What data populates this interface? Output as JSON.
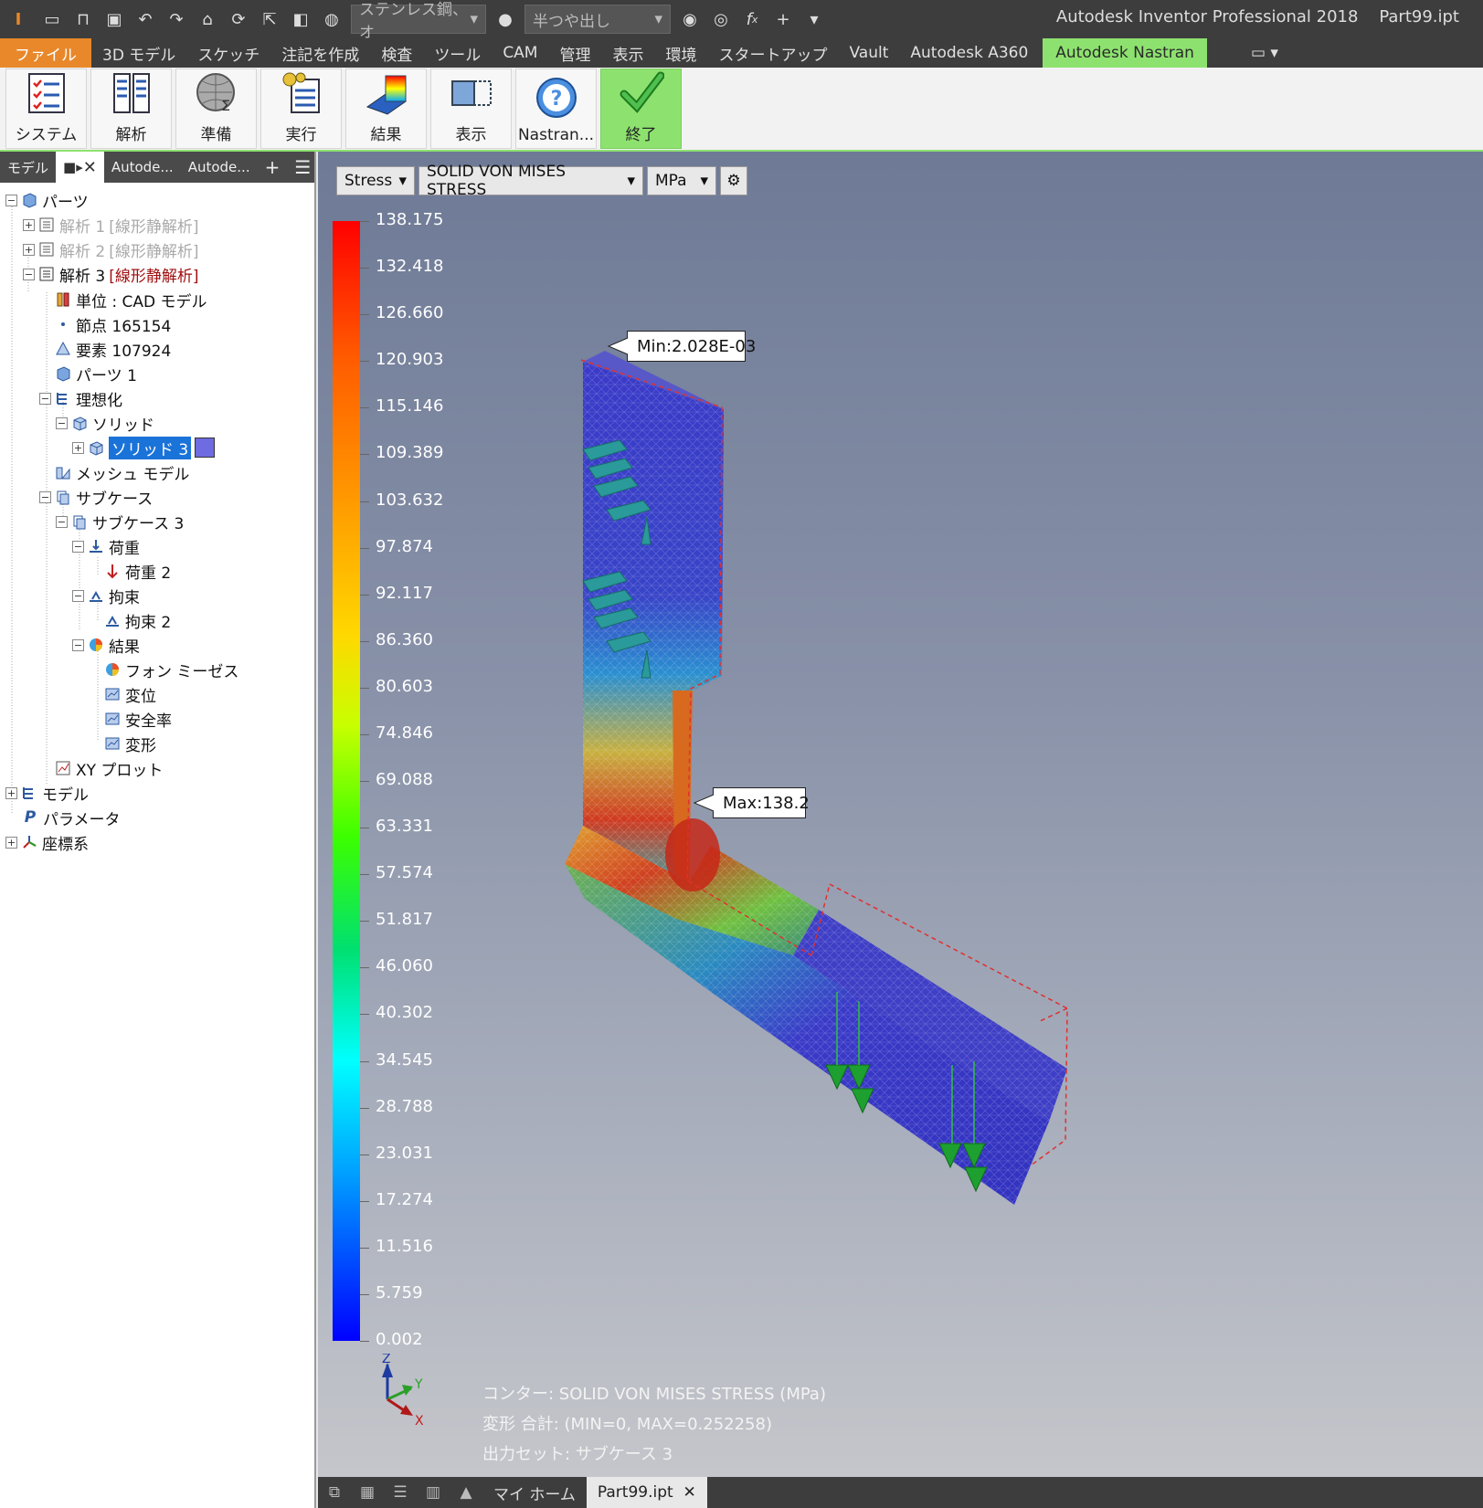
{
  "titlebar": {
    "material": "ステンレス鋼、オ",
    "appearance": "半つや出し",
    "app_title": "Autodesk Inventor Professional 2018",
    "file_name": "Part99.ipt",
    "fx_label": "f",
    "fx_sub": "x"
  },
  "menu": {
    "items": [
      "ファイル",
      "3D モデル",
      "スケッチ",
      "注記を作成",
      "検査",
      "ツール",
      "CAM",
      "管理",
      "表示",
      "環境",
      "スタートアップ",
      "Vault",
      "Autodesk A360",
      "Autodesk Nastran"
    ]
  },
  "ribbon": {
    "buttons": [
      "システム",
      "解析",
      "準備",
      "実行",
      "結果",
      "表示",
      "Nastran...",
      "終了"
    ]
  },
  "browser": {
    "tab_model": "モデル",
    "tab_a": "Autode...",
    "tab_b": "Autode...",
    "add": "+",
    "tree": {
      "parts": "パーツ",
      "analysis1": "解析 1",
      "analysis1_tag": "[線形静解析]",
      "analysis2": "解析 2",
      "analysis2_tag": "[線形静解析]",
      "analysis3": "解析 3",
      "analysis3_tag": "[線形静解析]",
      "units": "単位 : CAD モデル",
      "nodes": "節点 165154",
      "elements": "要素 107924",
      "part1": "パーツ 1",
      "idealization": "理想化",
      "solid": "ソリッド",
      "solid3": "ソリッド 3",
      "mesh": "メッシュ モデル",
      "subcase": "サブケース",
      "subcase3": "サブケース 3",
      "load": "荷重",
      "load2": "荷重 2",
      "constraint": "拘束",
      "constraint2": "拘束 2",
      "results": "結果",
      "vonmises": "フォン ミーゼス",
      "displacement": "変位",
      "safety": "安全率",
      "deform": "変形",
      "xyplot": "XY プロット",
      "model": "モデル",
      "params": "パラメータ",
      "coords": "座標系"
    }
  },
  "viewport": {
    "result_type": "Stress",
    "result_component": "SOLID VON MISES STRESS",
    "units": "MPa",
    "legend_values": [
      "138.175",
      "132.418",
      "126.660",
      "120.903",
      "115.146",
      "109.389",
      "103.632",
      "97.874",
      "92.117",
      "86.360",
      "80.603",
      "74.846",
      "69.088",
      "63.331",
      "57.574",
      "51.817",
      "46.060",
      "40.302",
      "34.545",
      "28.788",
      "23.031",
      "17.274",
      "11.516",
      "5.759",
      "0.002"
    ],
    "min_label": "Min:2.028E-03",
    "max_label": "Max:138.2",
    "info_contour": "コンター: SOLID VON MISES STRESS (MPa)",
    "info_deform": "変形 合計: (MIN=0, MAX=0.252258)",
    "info_output": "出力セット: サブケース 3",
    "axis_z": "Z",
    "axis_y": "Y",
    "axis_x": "X"
  },
  "status": {
    "home_tab": "マイ ホーム",
    "doc_tab": "Part99.ipt",
    "close": "✕"
  },
  "colors": {
    "accent_green": "#8de26f",
    "file_orange": "#e8882a",
    "selection_blue": "#1a73d9",
    "solid_swatch": "#6f6be0"
  }
}
